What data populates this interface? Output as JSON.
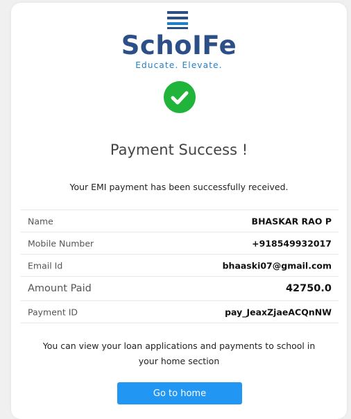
{
  "brand": {
    "name": "SchoIFe",
    "tagline": "Educate. Elevate.",
    "primary_color": "#2b4f86",
    "accent_color": "#1f7fc6"
  },
  "status": {
    "icon": "check-circle-icon",
    "color": "#20b43a",
    "title": "Payment Success !",
    "message": "Your EMI payment has been successfully received."
  },
  "details": [
    {
      "label": "Name",
      "value": "BHASKAR RAO P"
    },
    {
      "label": "Mobile Number",
      "value": "+918549932017"
    },
    {
      "label": "Email Id",
      "value": "bhaaski07@gmail.com"
    },
    {
      "label": "Amount Paid",
      "value": "42750.0"
    },
    {
      "label": "Payment ID",
      "value": "pay_JeaxZjaeACQnNW"
    }
  ],
  "note": "You can view your loan applications and payments to school in your home section",
  "actions": {
    "home_button_label": "Go to home",
    "button_color": "#2196f3"
  }
}
